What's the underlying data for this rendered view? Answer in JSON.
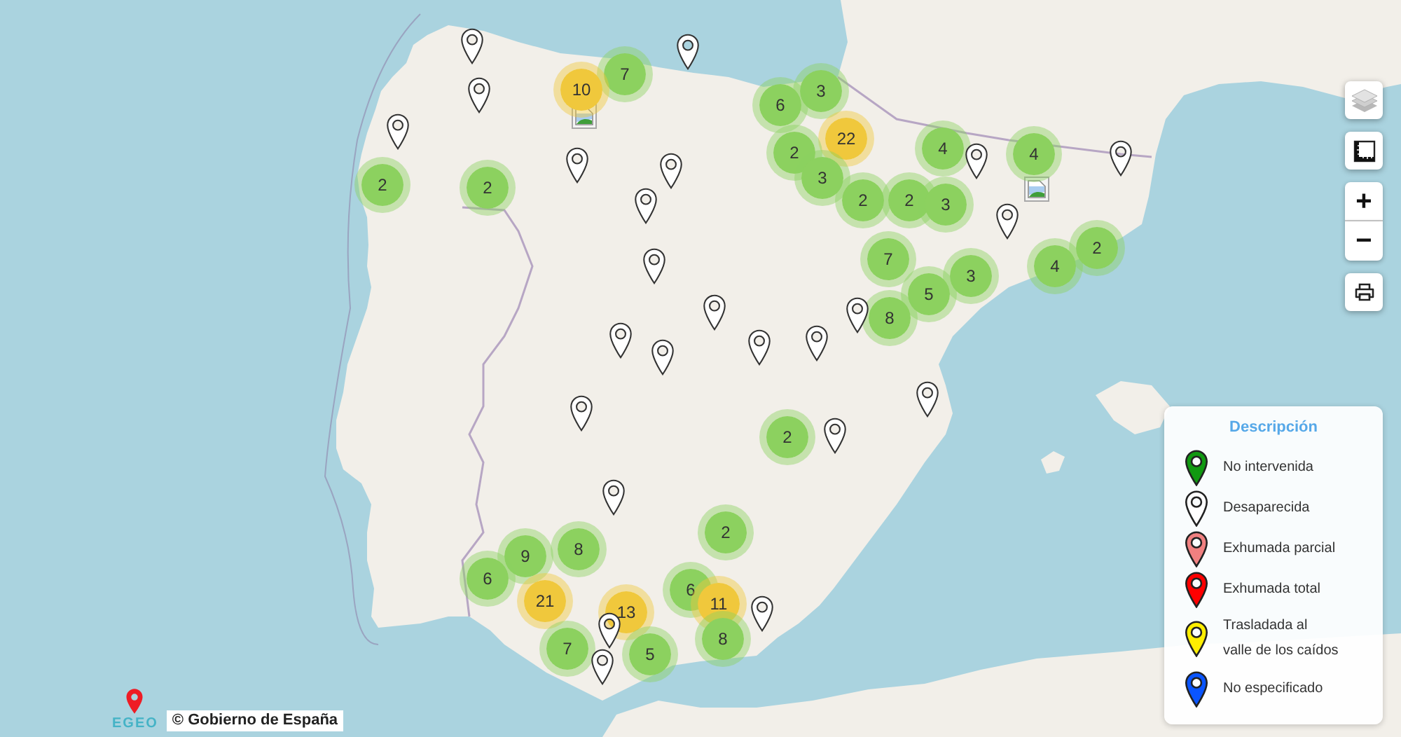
{
  "map": {
    "markers": [
      {
        "kind": "pin",
        "color": "#ffffff"
      },
      {
        "kind": "pin",
        "color": "#ffffff"
      },
      {
        "kind": "cluster",
        "count": "7",
        "color": "#8cd15f"
      },
      {
        "kind": "pin",
        "color": "#ffffff"
      },
      {
        "kind": "cluster",
        "count": "10",
        "color": "#f0c83c"
      },
      {
        "kind": "cluster",
        "count": "3",
        "color": "#8cd15f"
      },
      {
        "kind": "cluster",
        "count": "6",
        "color": "#8cd15f"
      },
      {
        "kind": "broken_image"
      },
      {
        "kind": "pin",
        "color": "#ffffff"
      },
      {
        "kind": "cluster",
        "count": "22",
        "color": "#f0c83c"
      },
      {
        "kind": "pin",
        "color": "#ffffff"
      },
      {
        "kind": "pin",
        "color": "#ffffff"
      },
      {
        "kind": "cluster",
        "count": "2",
        "color": "#8cd15f"
      },
      {
        "kind": "cluster",
        "count": "4",
        "color": "#8cd15f"
      },
      {
        "kind": "pin",
        "color": "#ffffff"
      },
      {
        "kind": "cluster",
        "count": "4",
        "color": "#8cd15f"
      },
      {
        "kind": "pin",
        "color": "#ffffff"
      },
      {
        "kind": "cluster",
        "count": "2",
        "color": "#8cd15f"
      },
      {
        "kind": "cluster",
        "count": "2",
        "color": "#8cd15f"
      },
      {
        "kind": "cluster",
        "count": "3",
        "color": "#8cd15f"
      },
      {
        "kind": "broken_image"
      },
      {
        "kind": "pin",
        "color": "#ffffff"
      },
      {
        "kind": "cluster",
        "count": "2",
        "color": "#8cd15f"
      },
      {
        "kind": "cluster",
        "count": "2",
        "color": "#8cd15f"
      },
      {
        "kind": "cluster",
        "count": "3",
        "color": "#8cd15f"
      },
      {
        "kind": "pin",
        "color": "#ffffff"
      },
      {
        "kind": "pin",
        "color": "#ffffff"
      },
      {
        "kind": "cluster",
        "count": "7",
        "color": "#8cd15f"
      },
      {
        "kind": "cluster",
        "count": "3",
        "color": "#8cd15f"
      },
      {
        "kind": "cluster",
        "count": "4",
        "color": "#8cd15f"
      },
      {
        "kind": "cluster",
        "count": "2",
        "color": "#8cd15f"
      },
      {
        "kind": "cluster",
        "count": "5",
        "color": "#8cd15f"
      },
      {
        "kind": "pin",
        "color": "#ffffff"
      },
      {
        "kind": "pin",
        "color": "#ffffff"
      },
      {
        "kind": "cluster",
        "count": "8",
        "color": "#8cd15f"
      },
      {
        "kind": "pin",
        "color": "#ffffff"
      },
      {
        "kind": "pin",
        "color": "#ffffff"
      },
      {
        "kind": "pin",
        "color": "#ffffff"
      },
      {
        "kind": "pin",
        "color": "#ffffff"
      },
      {
        "kind": "pin",
        "color": "#ffffff"
      },
      {
        "kind": "pin",
        "color": "#ffffff"
      },
      {
        "kind": "cluster",
        "count": "2",
        "color": "#8cd15f"
      },
      {
        "kind": "pin",
        "color": "#ffffff"
      },
      {
        "kind": "pin",
        "color": "#ffffff"
      },
      {
        "kind": "cluster",
        "count": "9",
        "color": "#8cd15f"
      },
      {
        "kind": "cluster",
        "count": "8",
        "color": "#8cd15f"
      },
      {
        "kind": "cluster",
        "count": "2",
        "color": "#8cd15f"
      },
      {
        "kind": "cluster",
        "count": "6",
        "color": "#8cd15f"
      },
      {
        "kind": "cluster",
        "count": "21",
        "color": "#f0c83c"
      },
      {
        "kind": "pin",
        "color": "#ffffff"
      },
      {
        "kind": "cluster",
        "count": "13",
        "color": "#f0c83c"
      },
      {
        "kind": "cluster",
        "count": "6",
        "color": "#8cd15f"
      },
      {
        "kind": "cluster",
        "count": "11",
        "color": "#f0c83c"
      },
      {
        "kind": "pin",
        "color": "#ffffff"
      },
      {
        "kind": "cluster",
        "count": "7",
        "color": "#8cd15f"
      },
      {
        "kind": "pin",
        "color": "#ffffff"
      },
      {
        "kind": "cluster",
        "count": "5",
        "color": "#8cd15f"
      },
      {
        "kind": "cluster",
        "count": "8",
        "color": "#8cd15f"
      }
    ]
  },
  "controls": {
    "zoom_in": "+",
    "zoom_out": "−"
  },
  "legend": {
    "title": "Descripción",
    "items": [
      {
        "label": "No intervenida",
        "color": "#119911"
      },
      {
        "label": "Desaparecida",
        "color": "#ffffff"
      },
      {
        "label": "Exhumada parcial",
        "color": "#f08080"
      },
      {
        "label": "Exhumada total",
        "color": "#ff0000"
      },
      {
        "label": "Trasladada al valle de los caídos",
        "color": "#ffee00"
      },
      {
        "label": "No especificado",
        "color": "#0a55ff"
      }
    ]
  },
  "attribution": {
    "logo": "EGEO",
    "text": "© Gobierno de España"
  }
}
